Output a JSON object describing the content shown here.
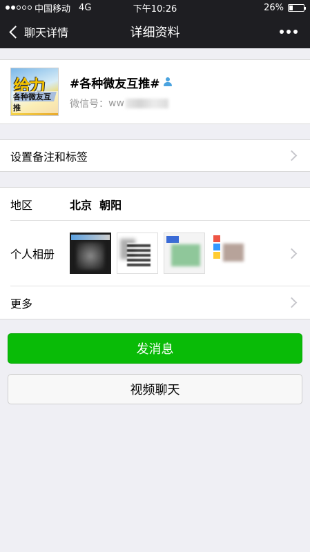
{
  "status_bar": {
    "carrier": "中国移动",
    "network": "4G",
    "time": "下午10:26",
    "battery": "26%",
    "battery_level": 0.26,
    "signal_bars_filled": 2,
    "signal_bars_total": 5
  },
  "nav": {
    "back_label": "聊天详情",
    "title": "详细资料"
  },
  "profile": {
    "nickname": "#各种微友互推#",
    "wechat_id_label": "微信号：",
    "wechat_id_visible": "ww",
    "avatar_text_top": "给力",
    "avatar_text_bottom": "各种微友互推"
  },
  "remark_row": {
    "label": "设置备注和标签"
  },
  "info": {
    "region_label": "地区",
    "region_value": "北京  朝阳",
    "album_label": "个人相册",
    "more_label": "更多"
  },
  "buttons": {
    "send_message": "发消息",
    "video_call": "视频聊天"
  },
  "colors": {
    "nav_bg": "#1e1e22",
    "primary_green": "#09bb07",
    "page_bg": "#efeff4"
  }
}
